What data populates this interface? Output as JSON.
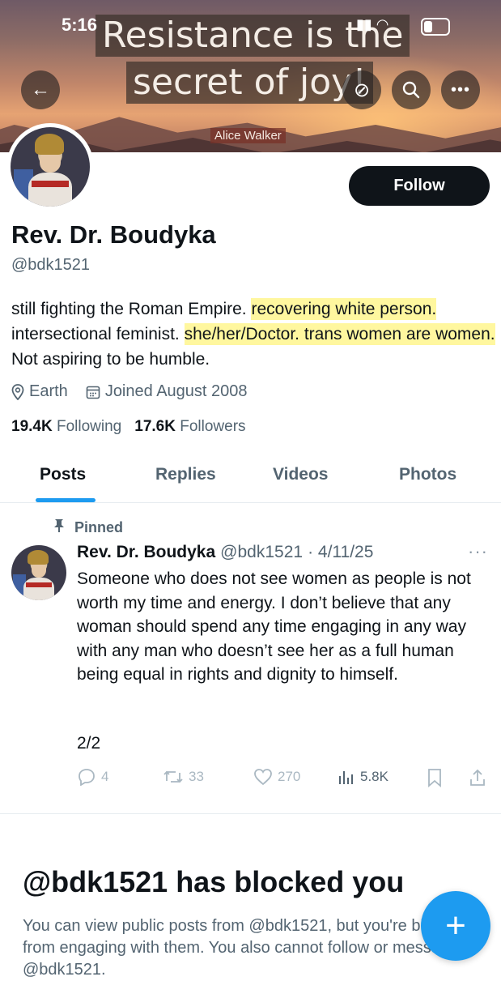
{
  "status_bar": {
    "time": "5:16"
  },
  "banner": {
    "quote_line1": "Resistance is the",
    "quote_line2": "secret of joy!",
    "quote_author": "Alice Walker"
  },
  "header_icons": {
    "back": "back-arrow-icon",
    "grok": "grok-icon",
    "search": "search-icon",
    "more": "more-icon"
  },
  "profile": {
    "display_name": "Rev. Dr. Boudyka",
    "handle": "@bdk1521",
    "follow_label": "Follow",
    "bio": {
      "part1": "still fighting the Roman Empire. ",
      "part2_highlight": "recovering white person.",
      "part3": " intersectional feminist. ",
      "part4_highlight": "she/her/Doctor. trans women are women.",
      "part5": " Not aspiring to be humble."
    },
    "location": "Earth",
    "joined": "Joined August 2008",
    "following_count": "19.4K",
    "following_label": "Following",
    "followers_count": "17.6K",
    "followers_label": "Followers"
  },
  "tabs": [
    {
      "label": "Posts",
      "active": true
    },
    {
      "label": "Replies",
      "active": false
    },
    {
      "label": "Videos",
      "active": false
    },
    {
      "label": "Photos",
      "active": false
    }
  ],
  "post": {
    "pinned_label": "Pinned",
    "author_name": "Rev. Dr. Boudyka",
    "author_handle": "@bdk1521",
    "date": "· 4/11/25",
    "text": "Someone who does not see women as people is not worth my time and energy. I don’t believe that any woman should spend any time engaging in any way with any man who doesn’t see her as a full human being equal in rights and dignity to himself.",
    "page_indicator": "2/2",
    "replies": "4",
    "reposts": "33",
    "likes": "270",
    "views": "5.8K",
    "more_label": "···"
  },
  "blocked": {
    "title": "@bdk1521 has blocked you",
    "description": "You can view public posts from @bdk1521, but you're blocked from engaging with them. You also cannot follow or message @bdk1521."
  },
  "fab_label": "+",
  "colors": {
    "accent": "#1d9bf0",
    "text": "#0f1419",
    "muted": "#536471",
    "highlight": "#fff050"
  }
}
